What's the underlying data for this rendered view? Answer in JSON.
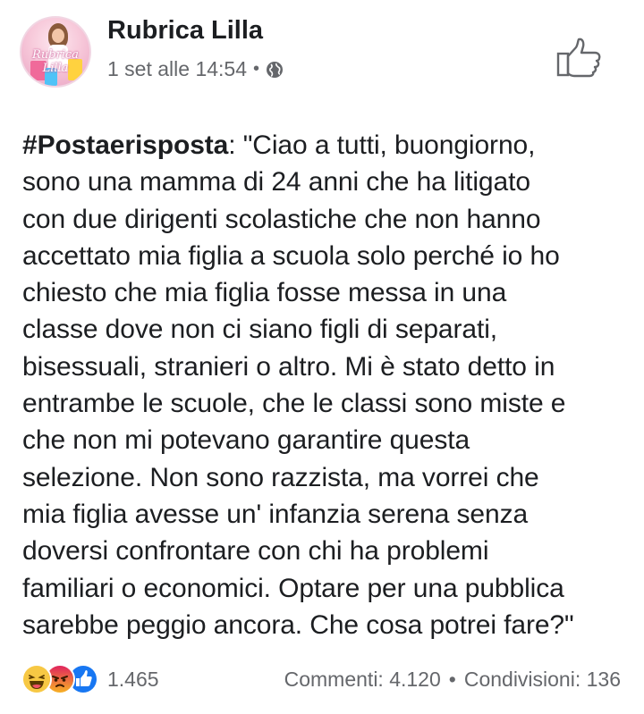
{
  "post": {
    "page_name": "Rubrica Lilla",
    "avatar_logo_text": "Rubrica Lilla",
    "timestamp": "1 set alle 14:54",
    "separator": "•",
    "privacy_icon": "globe-icon",
    "like_icon": "thumbs-up-icon",
    "hashtag": "#Postaerisposta",
    "first_line_rest": ": \"Ciao a tutti, buongiorno,",
    "lines": [
      "sono una mamma di 24 anni che ha litigato",
      "con due dirigenti scolastiche che non hanno",
      "accettato mia figlia a scuola solo perché io ho",
      "chiesto che mia figlia fosse messa in una",
      "classe dove non ci siano figli di separati,",
      "bisessuali, stranieri o altro. Mi è stato detto in",
      "entrambe le scuole, che le classi sono miste e",
      "che non mi potevano garantire questa",
      "selezione. Non sono razzista, ma vorrei che",
      "mia figlia avesse un' infanzia serena senza",
      "doversi confrontare con chi ha problemi",
      "familiari o economici. Optare per una pubblica",
      "sarebbe peggio ancora. Che cosa potrei fare?\""
    ]
  },
  "footer": {
    "reactions": [
      "haha",
      "angry",
      "like"
    ],
    "reaction_count": "1.465",
    "comments": "Commenti: 4.120",
    "separator": "•",
    "shares": "Condivisioni: 136"
  },
  "colors": {
    "text": "#1c1e21",
    "meta": "#65676b",
    "like_blue": "#1877f2",
    "haha_yellow": "#f7c844",
    "angry_red": "#e9710f"
  }
}
